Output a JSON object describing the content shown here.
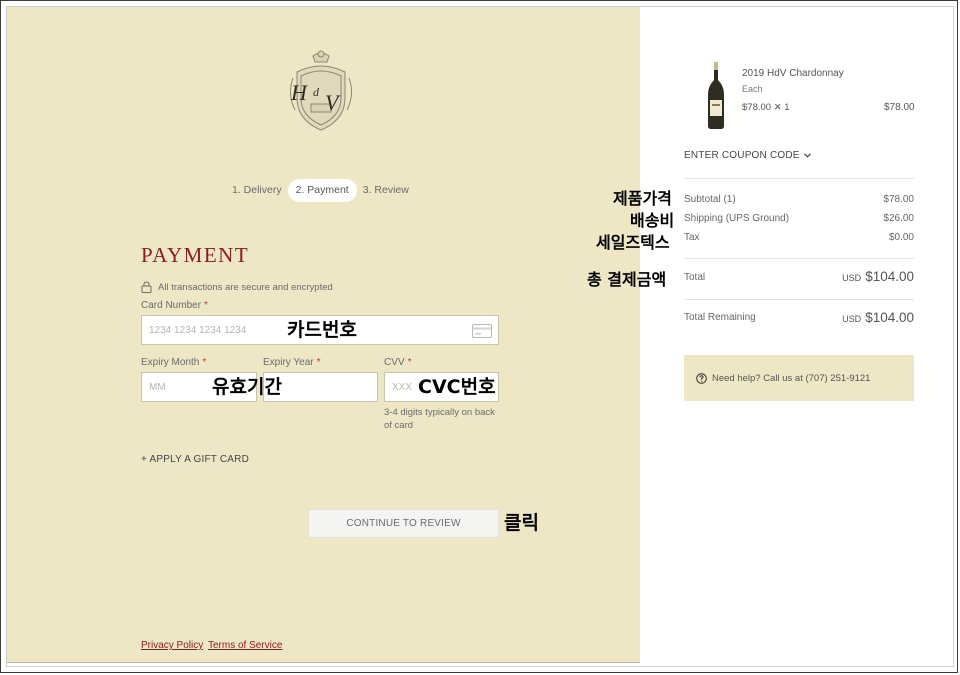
{
  "steps": [
    {
      "label": "1. Delivery"
    },
    {
      "label": "2. Payment"
    },
    {
      "label": "3. Review"
    }
  ],
  "payment": {
    "title": "PAYMENT",
    "secure_note": "All transactions are secure and encrypted",
    "card_number_label": "Card Number",
    "card_number_placeholder": "1234 1234 1234 1234",
    "expiry_month_label": "Expiry Month",
    "expiry_month_placeholder": "MM",
    "expiry_year_label": "Expiry Year",
    "cvv_label": "CVV",
    "cvv_placeholder": "XXX",
    "cvv_help": "3-4 digits typically on back of card",
    "required_mark": "*",
    "gift_card": "+ APPLY A GIFT CARD",
    "continue_label": "CONTINUE TO REVIEW"
  },
  "footer": {
    "privacy": "Privacy Policy",
    "terms": "Terms of Service"
  },
  "annotations": {
    "card_number": "카드번호",
    "expiry": "유효기간",
    "cvc": "CVC번호",
    "click": "클릭",
    "product_price": "제품가격",
    "shipping": "배송비",
    "sales_tax": "세일즈텍스",
    "total_payment": "총 결제금액"
  },
  "order": {
    "product_name": "2019 HdV Chardonnay",
    "product_unit": "Each",
    "product_qty": "$78.00 ✕ 1",
    "product_price": "$78.00",
    "coupon_label": "ENTER COUPON CODE",
    "subtotal_label": "Subtotal (1)",
    "subtotal_value": "$78.00",
    "shipping_label": "Shipping (UPS Ground)",
    "shipping_value": "$26.00",
    "tax_label": "Tax",
    "tax_value": "$0.00",
    "total_label": "Total",
    "total_currency": "USD",
    "total_value": "$104.00",
    "remaining_label": "Total Remaining",
    "remaining_currency": "USD",
    "remaining_value": "$104.00",
    "help_text": "Need help? Call us at (707) 251-9121"
  },
  "colors": {
    "left_background": "#ede7c6",
    "brand_red": "#8b1c1c",
    "help_background": "#ede7c6"
  },
  "icons": [
    "crest-logo",
    "lock-icon",
    "credit-card-icon",
    "wine-bottle-icon",
    "chevron-down-icon",
    "question-circle-icon"
  ]
}
